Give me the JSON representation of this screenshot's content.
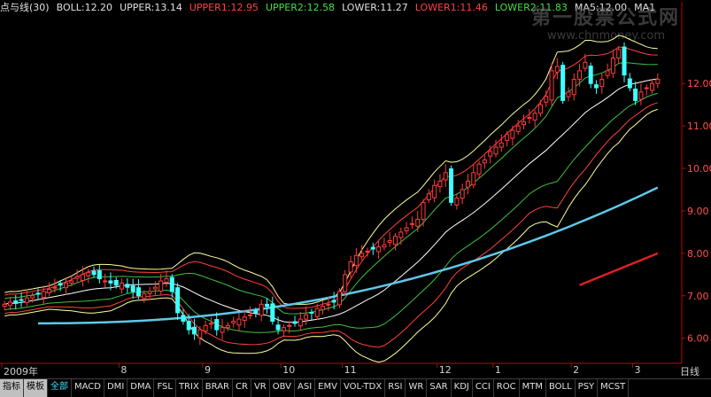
{
  "legend": [
    {
      "text": "点与线(30)",
      "color": "#e0e0e0"
    },
    {
      "text": "BOLL:12.20",
      "color": "#e0e0e0"
    },
    {
      "text": "UPPER:13.14",
      "color": "#e0e0e0"
    },
    {
      "text": "UPPER1:12.95",
      "color": "#ff4040"
    },
    {
      "text": "UPPER2:12.58",
      "color": "#40e040"
    },
    {
      "text": "LOWER:11.27",
      "color": "#e0e0e0"
    },
    {
      "text": "LOWER1:11.46",
      "color": "#ff4040"
    },
    {
      "text": "LOWER2:11.83",
      "color": "#40e040"
    },
    {
      "text": "MA5:12.00",
      "color": "#e0e0e0"
    },
    {
      "text": "MA1",
      "color": "#e0e0e0"
    }
  ],
  "watermark": {
    "title": "第一股票公式网",
    "url": "www.chnmoney.com"
  },
  "yaxis": [
    {
      "value": 12.0,
      "label": "12.00"
    },
    {
      "value": 11.0,
      "label": "11.00"
    },
    {
      "value": 10.0,
      "label": "10.00"
    },
    {
      "value": 9.0,
      "label": "9.00"
    },
    {
      "value": 8.0,
      "label": "8.00"
    },
    {
      "value": 7.0,
      "label": "7.00"
    },
    {
      "value": 6.0,
      "label": "6.00"
    }
  ],
  "yaxis_range": [
    5.45,
    13.55
  ],
  "time_axis": [
    {
      "label": "2009年",
      "index": 0
    },
    {
      "label": "8",
      "index": 21
    },
    {
      "label": "9",
      "index": 36
    },
    {
      "label": "10",
      "index": 50
    },
    {
      "label": "11",
      "index": 61
    },
    {
      "label": "12",
      "index": 78
    },
    {
      "label": "1",
      "index": 88
    },
    {
      "label": "2",
      "index": 102
    },
    {
      "label": "3",
      "index": 113
    }
  ],
  "period_label": "日线",
  "tabs": [
    "指标",
    "模板",
    "全部",
    "MACD",
    "DMI",
    "DMA",
    "FSL",
    "TRIX",
    "BRAR",
    "CR",
    "VR",
    "OBV",
    "ASI",
    "EMV",
    "VOL-TDX",
    "RSI",
    "WR",
    "SAR",
    "KDJ",
    "CCI",
    "ROC",
    "MTM",
    "BOLL",
    "PSY",
    "MCST"
  ],
  "colors": {
    "up_candle": "#ff3b3b",
    "down_candle": "#40ffff",
    "boll_mid": "#ffffff",
    "upper_lower": "#ffff99",
    "band1": "#ff4040",
    "band2": "#40c040",
    "long_ma_cyan": "#5fc8e8",
    "long_ma_red": "#e02020",
    "axis": "#c00000"
  },
  "chart_data": {
    "type": "candlestick",
    "series_close": [
      6.8,
      6.85,
      6.82,
      6.9,
      6.95,
      7.0,
      7.05,
      7.1,
      7.15,
      7.2,
      7.25,
      7.3,
      7.35,
      7.45,
      7.5,
      7.55,
      7.5,
      7.4,
      7.35,
      7.3,
      7.25,
      7.3,
      7.2,
      7.1,
      7.0,
      7.05,
      7.1,
      7.2,
      7.35,
      7.4,
      7.1,
      6.6,
      6.4,
      6.2,
      6.1,
      6.2,
      6.3,
      6.35,
      6.2,
      6.25,
      6.3,
      6.4,
      6.45,
      6.5,
      6.55,
      6.6,
      6.8,
      6.75,
      6.4,
      6.2,
      6.25,
      6.3,
      6.35,
      6.45,
      6.55,
      6.6,
      6.7,
      6.75,
      6.8,
      6.85,
      7.1,
      7.5,
      7.8,
      7.95,
      8.0,
      8.05,
      8.1,
      8.15,
      8.2,
      8.3,
      8.4,
      8.5,
      8.6,
      8.7,
      8.8,
      9.2,
      9.4,
      9.6,
      9.7,
      9.9,
      9.2,
      9.3,
      9.5,
      9.7,
      9.9,
      10.1,
      10.2,
      10.4,
      10.5,
      10.6,
      10.8,
      10.9,
      11.0,
      11.1,
      11.2,
      11.3,
      11.5,
      11.7,
      12.3,
      12.4,
      11.6,
      11.8,
      12.1,
      12.3,
      12.5,
      12.0,
      11.9,
      12.1,
      12.3,
      12.6,
      12.8,
      12.2,
      11.9,
      11.6,
      11.8,
      11.9,
      12.0,
      12.1
    ],
    "long_ma_cyan": {
      "start_index": 6,
      "start": 6.35,
      "end": 9.55
    },
    "long_ma_red": {
      "start_index": 103,
      "start": 7.25,
      "end": 8.0
    }
  }
}
